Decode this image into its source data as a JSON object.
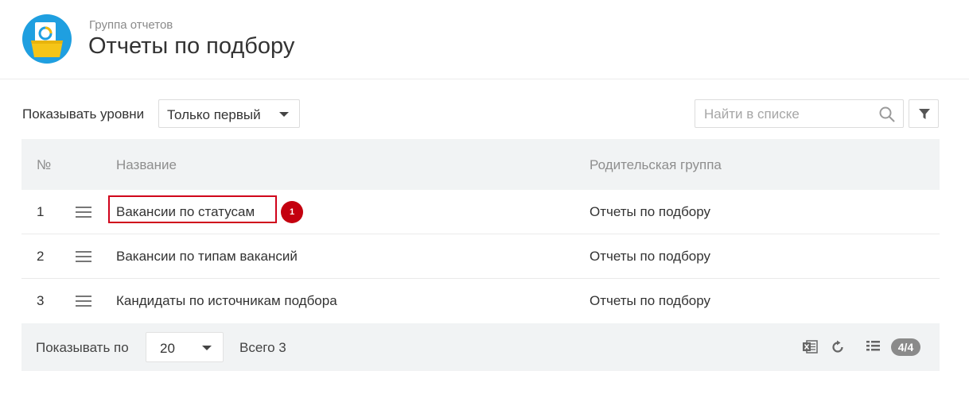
{
  "header": {
    "group_label": "Группа отчетов",
    "title": "Отчеты по подбору",
    "logo_icon": "folder-report-icon",
    "logo_color": "#1f9fe0"
  },
  "toolbar": {
    "levels_label": "Показывать уровни",
    "levels_value": "Только первый",
    "search_placeholder": "Найти в списке",
    "search_icon": "search-icon",
    "filter_icon": "filter-icon"
  },
  "table": {
    "columns": [
      "№",
      "Название",
      "Родительская группа"
    ],
    "rows": [
      {
        "num": "1",
        "name": "Вакансии по статусам",
        "parent": "Отчеты по подбору"
      },
      {
        "num": "2",
        "name": "Вакансии по типам вакансий",
        "parent": "Отчеты по подбору"
      },
      {
        "num": "3",
        "name": "Кандидаты по источникам подбора",
        "parent": "Отчеты по подбору"
      }
    ],
    "highlight": {
      "row": 1,
      "badge": "1",
      "color": "#d0021b"
    }
  },
  "footer": {
    "per_page_label": "Показывать по",
    "per_page_value": "20",
    "total_label": "Всего 3",
    "count_badge": "4/4",
    "icons": [
      "excel-export-icon",
      "refresh-icon",
      "columns-list-icon"
    ]
  }
}
